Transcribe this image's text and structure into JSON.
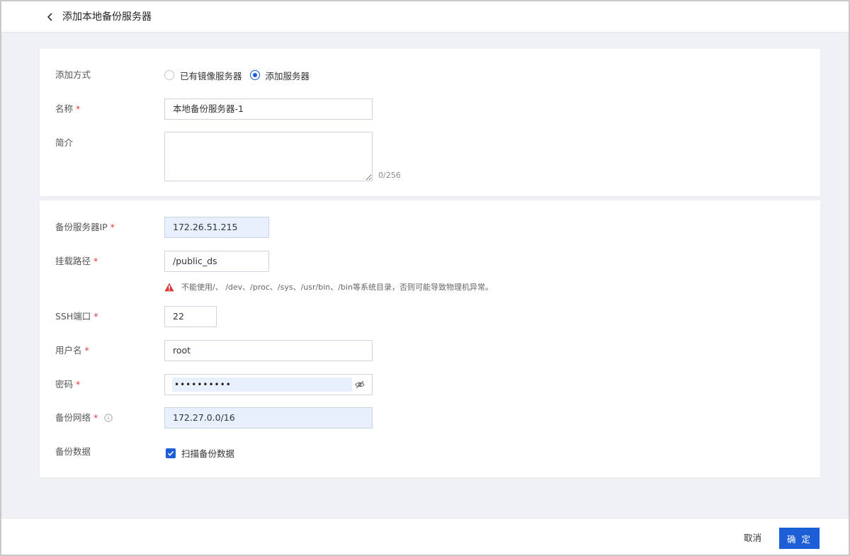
{
  "header": {
    "title": "添加本地备份服务器"
  },
  "form": {
    "add_method": {
      "label": "添加方式",
      "options": [
        {
          "label": "已有镜像服务器",
          "checked": false
        },
        {
          "label": "添加服务器",
          "checked": true
        }
      ]
    },
    "name": {
      "label": "名称",
      "value": "本地备份服务器-1"
    },
    "description": {
      "label": "简介",
      "value": "",
      "counter": "0/256"
    },
    "backup_ip": {
      "label": "备份服务器IP",
      "value": "172.26.51.215"
    },
    "mount_path": {
      "label": "挂载路径",
      "value": "/public_ds",
      "warning": "不能使用/、 /dev、/proc、/sys、/usr/bin、/bin等系统目录，否则可能导致物理机异常。"
    },
    "ssh_port": {
      "label": "SSH端口",
      "value": "22"
    },
    "username": {
      "label": "用户名",
      "value": "root"
    },
    "password": {
      "label": "密码",
      "value": "••••••••••"
    },
    "backup_network": {
      "label": "备份网络",
      "value": "172.27.0.0/16"
    },
    "backup_data": {
      "label": "备份数据",
      "checkbox_label": "扫描备份数据",
      "checked": true
    },
    "required_mark": "*"
  },
  "footer": {
    "cancel": "取消",
    "confirm": "确 定"
  },
  "colors": {
    "primary": "#1c5ed6",
    "required": "#e0393e",
    "warning": "#e0393e",
    "autofill": "#e8f0fe"
  },
  "icons": {
    "back": "chevron-left-icon",
    "info": "info-icon",
    "warning": "warning-triangle-icon",
    "eye": "eye-off-icon",
    "check": "check-icon"
  }
}
